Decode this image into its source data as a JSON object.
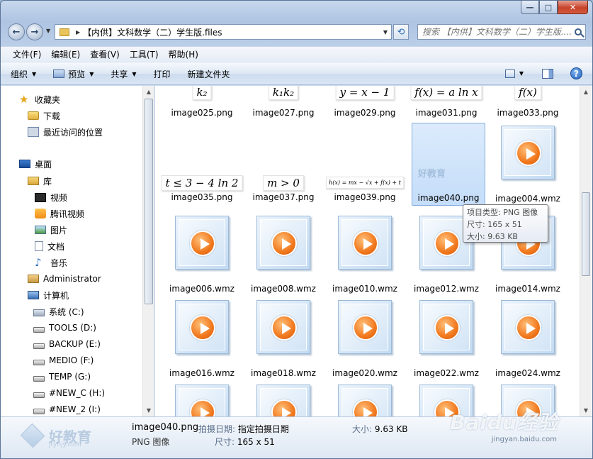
{
  "window": {
    "min_label": "—",
    "max_label": "□",
    "close_label": "✕"
  },
  "address": {
    "path_text": "【内供】文科数学（二）学生版.files",
    "search_placeholder": "搜索 【内供】文科数学（二）学生版...."
  },
  "menu": [
    "文件(F)",
    "编辑(E)",
    "查看(V)",
    "工具(T)",
    "帮助(H)"
  ],
  "commands": {
    "organize": "组织",
    "preview": "预览",
    "share": "共享",
    "print": "打印",
    "new_folder": "新建文件夹"
  },
  "nav": {
    "favorites": "收藏夹",
    "downloads": "下载",
    "recent": "最近访问的位置",
    "desktop": "桌面",
    "library": "库",
    "video": "视频",
    "tencent_video": "腾讯视频",
    "pictures": "图片",
    "documents": "文档",
    "music": "音乐",
    "admin": "Administrator",
    "computer": "计算机",
    "drives": [
      "系统 (C:)",
      "TOOLS (D:)",
      "BACKUP (E:)",
      "MEDIO (F:)",
      "TEMP (G:)",
      "#NEW_C (H:)",
      "#NEW_2 (I:)"
    ]
  },
  "files": {
    "row1": [
      {
        "name": "image025.png",
        "formula": "k₂"
      },
      {
        "name": "image027.png",
        "formula": "k₁k₂"
      },
      {
        "name": "image029.png",
        "formula": "y = x − 1"
      },
      {
        "name": "image031.png",
        "formula": "f(x) = a ln x"
      },
      {
        "name": "image033.png",
        "formula": "f(x)"
      }
    ],
    "row2": [
      {
        "name": "image035.png",
        "formula": "t ≤ 3 − 4 ln 2"
      },
      {
        "name": "image037.png",
        "formula": "m > 0"
      },
      {
        "name": "image039.png",
        "formula": "h(x) = mx − √x + f(x) + t"
      },
      {
        "name": "image040.png",
        "logo": "好教育"
      },
      {
        "name": "image004.wmz"
      }
    ],
    "row3": [
      "image006.wmz",
      "image008.wmz",
      "image010.wmz",
      "image012.wmz",
      "image014.wmz"
    ],
    "row4": [
      "image016.wmz",
      "image018.wmz",
      "image020.wmz",
      "image022.wmz",
      "image024.wmz"
    ]
  },
  "tooltip": {
    "type": "项目类型: PNG 图像",
    "size_dim": "尺寸: 165 x 51",
    "file_size": "大小: 9.63 KB"
  },
  "details": {
    "logo_text": "好教育",
    "logo_sub": "jtyhjy.com",
    "filename": "image040.png",
    "filetype": "PNG 图像",
    "date_label": "拍摄日期:",
    "date_value": "指定拍摄日期",
    "dim_label": "尺寸:",
    "dim_value": "165 x 51",
    "size_label": "大小:",
    "size_value": "9.63 KB"
  },
  "watermark": {
    "brand": "Baidu经验",
    "url": "jingyan.baidu.com"
  }
}
